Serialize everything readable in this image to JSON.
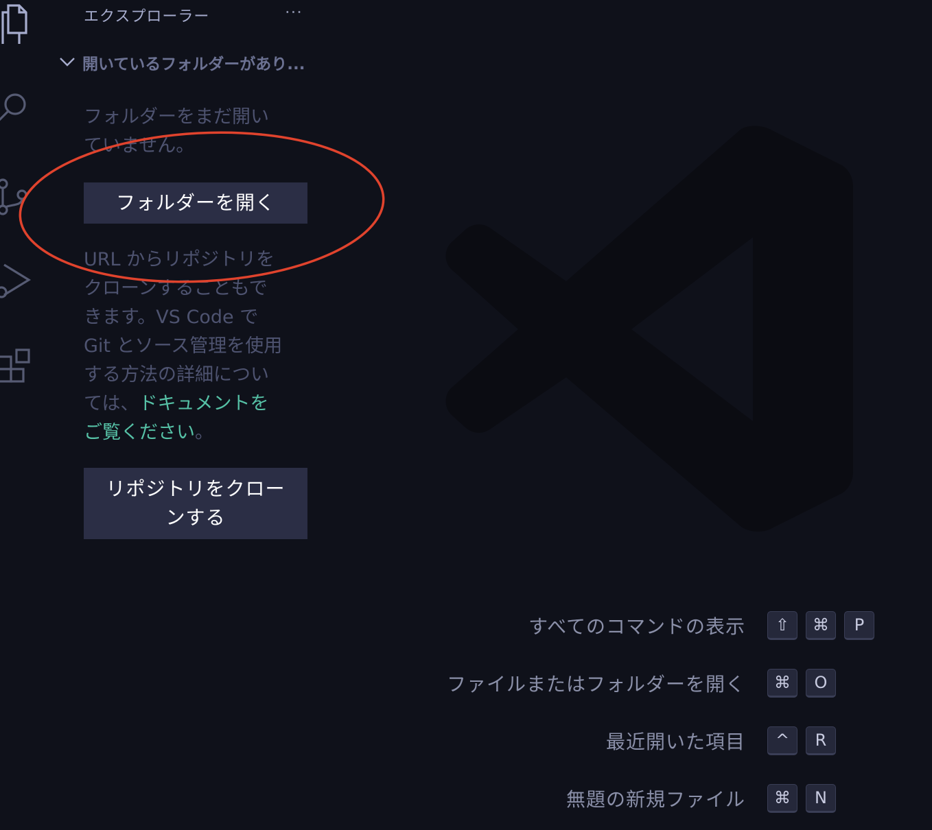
{
  "explorer": {
    "title": "エクスプローラー",
    "more_actions_label": "···",
    "section_label": "開いているフォルダーがあり...",
    "no_folder_text_line1": "フォルダーをまだ開い",
    "no_folder_text_line2": "ていません。",
    "open_folder_button": "フォルダーを開く",
    "clone_info_lines": [
      "URL からリポジトリを",
      "クローンすることもで",
      "きます。VS Code で",
      "Git とソース管理を使用",
      "する方法の詳細につい"
    ],
    "clone_info_prefix": "ては、",
    "docs_link_part1": "ドキュメントを",
    "docs_link_part2": "ご覧ください",
    "clone_info_suffix": "。",
    "clone_button_line1": "リポジトリをクロー",
    "clone_button_line2": "ンする"
  },
  "shortcuts": [
    {
      "label": "すべてのコマンドの表示",
      "keys": [
        "⇧",
        "⌘",
        "P"
      ]
    },
    {
      "label": "ファイルまたはフォルダーを開く",
      "keys": [
        "⌘",
        "O"
      ]
    },
    {
      "label": "最近開いた項目",
      "keys": [
        "^",
        "R"
      ]
    },
    {
      "label": "無題の新規ファイル",
      "keys": [
        "⌘",
        "N"
      ]
    }
  ],
  "activity_bar": {
    "icons": [
      "files-icon",
      "search-icon",
      "source-control-icon",
      "run-debug-icon",
      "extensions-icon"
    ]
  },
  "colors": {
    "background": "#0f111a",
    "button": "#2b2e45",
    "link": "#56c1a6",
    "annotation_circle": "#e0432d"
  }
}
